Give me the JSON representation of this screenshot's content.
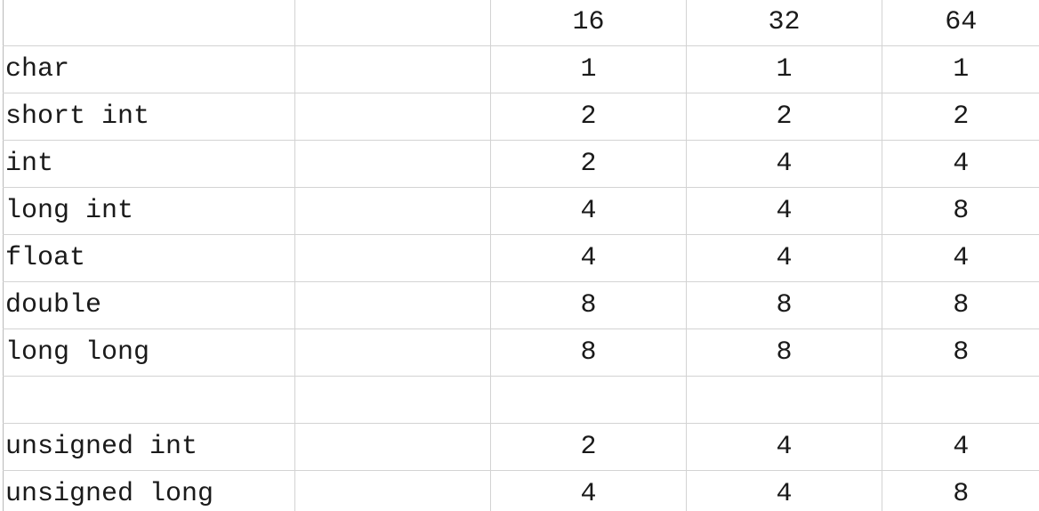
{
  "table": {
    "row_label_header": "",
    "column_headers": [
      "",
      "",
      "16",
      "32",
      "64"
    ],
    "rows": [
      {
        "name": "char",
        "values": [
          "1",
          "1",
          "1"
        ]
      },
      {
        "name": "short int",
        "values": [
          "2",
          "2",
          "2"
        ]
      },
      {
        "name": "int",
        "values": [
          "2",
          "4",
          "4"
        ]
      },
      {
        "name": "long int",
        "values": [
          "4",
          "4",
          "8"
        ]
      },
      {
        "name": "float",
        "values": [
          "4",
          "4",
          "4"
        ]
      },
      {
        "name": "double",
        "values": [
          "8",
          "8",
          "8"
        ]
      },
      {
        "name": "long long",
        "values": [
          "8",
          "8",
          "8"
        ]
      },
      {
        "name": "",
        "values": [
          "",
          "",
          ""
        ]
      },
      {
        "name": "unsigned int",
        "values": [
          "2",
          "4",
          "4"
        ]
      },
      {
        "name": "unsigned long",
        "values": [
          "4",
          "4",
          "8"
        ]
      }
    ]
  },
  "chart_data": {
    "type": "table",
    "title": "",
    "categories": [
      "char",
      "short int",
      "int",
      "long int",
      "float",
      "double",
      "long long",
      "",
      "unsigned int",
      "unsigned long"
    ],
    "series": [
      {
        "name": "16",
        "values": [
          1,
          2,
          2,
          4,
          4,
          8,
          8,
          null,
          2,
          4
        ]
      },
      {
        "name": "32",
        "values": [
          1,
          2,
          4,
          4,
          4,
          8,
          8,
          null,
          4,
          4
        ]
      },
      {
        "name": "64",
        "values": [
          1,
          2,
          4,
          8,
          4,
          8,
          8,
          null,
          4,
          8
        ]
      }
    ],
    "xlabel": "",
    "ylabel": "",
    "legend": [
      "16",
      "32",
      "64"
    ],
    "grid": true
  },
  "colors": {
    "grid_line": "#d3d3d3",
    "edge_line": "#b9b9b9",
    "text": "#1a1a1a",
    "background": "#ffffff"
  }
}
